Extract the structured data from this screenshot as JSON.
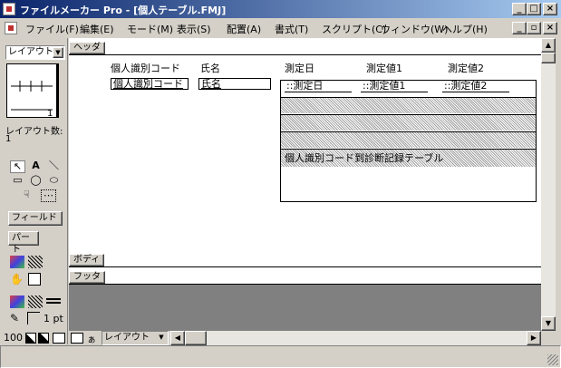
{
  "window": {
    "title": "ファイルメーカー Pro - [個人テーブル.FMJ]",
    "minimize": "_",
    "maximize": "□",
    "close": "×"
  },
  "menus": [
    "ファイル(F)",
    "編集(E)",
    "モード(M)",
    "表示(S)",
    "配置(A)",
    "書式(T)",
    "スクリプト(C)",
    "ウィンドウ(W)",
    "ヘルプ(H)"
  ],
  "doc_controls": {
    "minimize": "_",
    "restore": "▫",
    "close": "×"
  },
  "tool_panel": {
    "layout_selector": "レイアウト1",
    "book_page": "1",
    "layout_count_label": "レイアウト数:",
    "layout_count": "1",
    "tools": [
      "↖",
      "A",
      "＼",
      "▭",
      "◯",
      "⬭",
      "☟",
      "⋯"
    ],
    "field_button": "フィールド",
    "part_button": "パート",
    "line_width": "1 pt"
  },
  "layout": {
    "header_part": "ヘッダ",
    "body_part": "ボディ",
    "footer_part": "フッタ",
    "column_labels": [
      "個人識別コード",
      "氏名",
      "測定日",
      "測定値1",
      "測定値2"
    ],
    "fields": [
      "個人識別コード",
      "氏名",
      "::測定日",
      "::測定値1",
      "::測定値2"
    ],
    "portal_relation": "個人識別コード到診断記録テーブル"
  },
  "bottom_bar": {
    "zoom": "100",
    "mode_selector": "レイアウト"
  }
}
